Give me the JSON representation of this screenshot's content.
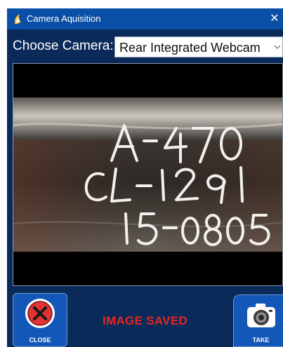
{
  "window": {
    "title": "Camera Aquisition",
    "close_glyph": "✕",
    "title_icon": "app-logo-icon"
  },
  "camera": {
    "label": "Choose Camera:",
    "selected": "Rear Integrated Webcam"
  },
  "preview": {
    "photo_text": [
      "A-470",
      "CL-1291",
      "15-0805"
    ]
  },
  "buttons": {
    "close_label": "CLOSE",
    "take_label": "TAKE"
  },
  "status": {
    "message": "IMAGE SAVED",
    "color": "#e4281f"
  },
  "colors": {
    "titlebar": "#0a4fa6",
    "window_bg": "#0a2a5a",
    "button": "#1358b8"
  }
}
